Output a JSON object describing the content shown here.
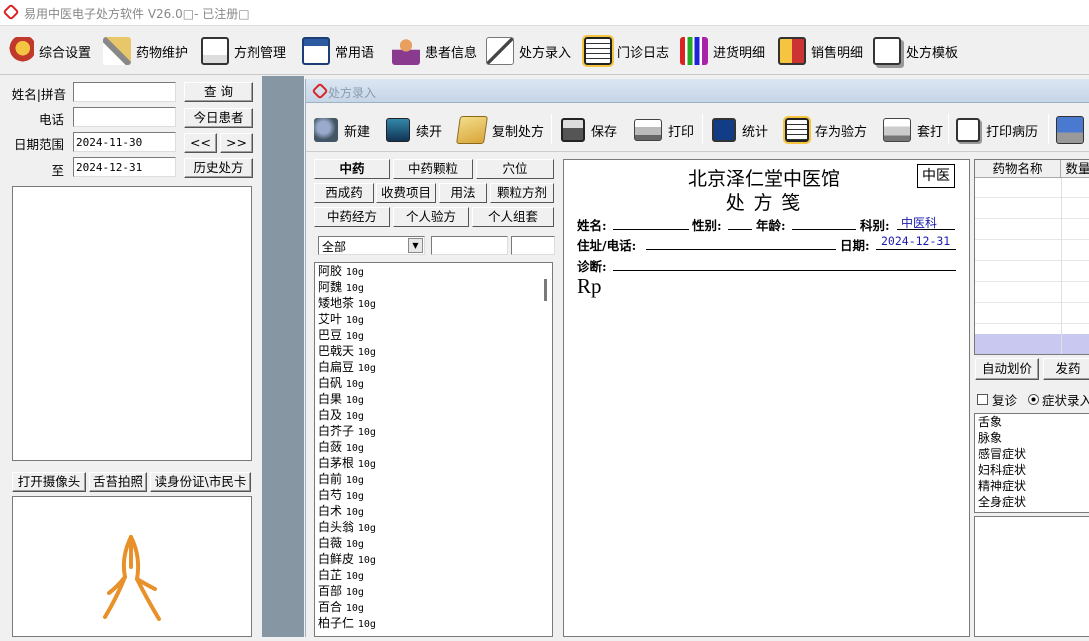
{
  "app": {
    "title": "易用中医电子处方软件 V26.0□- 已注册□"
  },
  "toolbar": [
    {
      "label": "综合设置",
      "icon": "settings-icon"
    },
    {
      "label": "药物维护",
      "icon": "medicine-icon"
    },
    {
      "label": "方剂管理",
      "icon": "formula-icon"
    },
    {
      "label": "常用语",
      "icon": "phrases-icon"
    },
    {
      "label": "患者信息",
      "icon": "patients-icon"
    },
    {
      "label": "处方录入",
      "icon": "prescription-icon"
    },
    {
      "label": "门诊日志",
      "icon": "clinic-log-icon"
    },
    {
      "label": "进货明细",
      "icon": "purchase-chart-icon"
    },
    {
      "label": "销售明细",
      "icon": "sales-icon"
    },
    {
      "label": "处方模板",
      "icon": "template-icon"
    }
  ],
  "left": {
    "name_label": "姓名|拼音",
    "phone_label": "电话",
    "date_label": "日期范围",
    "to_label": "至",
    "date_from": "2024-11-30",
    "date_to": "2024-12-31",
    "query_btn": "查  询",
    "today_btn": "今日患者",
    "prev_btn": "<<",
    "next_btn": ">>",
    "history_btn": "历史处方",
    "camera_btn": "打开摄像头",
    "tongue_btn": "舌苔拍照",
    "idcard_btn": "读身份证\\市民卡"
  },
  "window": {
    "title": "处方录入",
    "toolbar": [
      {
        "label": "新建",
        "icon": "new-icon"
      },
      {
        "label": "续开",
        "icon": "continue-icon"
      },
      {
        "label": "复制处方",
        "icon": "copy-folder-icon"
      },
      {
        "label": "保存",
        "icon": "save-icon"
      },
      {
        "label": "打印",
        "icon": "printer-icon"
      },
      {
        "label": "统计",
        "icon": "stats-icon"
      },
      {
        "label": "存为验方",
        "icon": "save-recipe-icon"
      },
      {
        "label": "套打",
        "icon": "overlay-print-icon"
      },
      {
        "label": "打印病历",
        "icon": "print-record-icon"
      }
    ]
  },
  "tabs": {
    "row1": [
      "中药",
      "中药颗粒",
      "穴位"
    ],
    "row2": [
      "西成药",
      "收费项目",
      "用法",
      "颗粒方剂"
    ],
    "row3": [
      "中药经方",
      "个人验方",
      "个人组套"
    ]
  },
  "filter": {
    "category": "全部"
  },
  "herbs": [
    {
      "name": "阿胶",
      "dose": "10g"
    },
    {
      "name": "阿魏",
      "dose": "10g"
    },
    {
      "name": "矮地茶",
      "dose": "10g"
    },
    {
      "name": "艾叶",
      "dose": "10g"
    },
    {
      "name": "巴豆",
      "dose": "10g"
    },
    {
      "name": "巴戟天",
      "dose": "10g"
    },
    {
      "name": "白扁豆",
      "dose": "10g"
    },
    {
      "name": "白矾",
      "dose": "10g"
    },
    {
      "name": "白果",
      "dose": "10g"
    },
    {
      "name": "白及",
      "dose": "10g"
    },
    {
      "name": "白芥子",
      "dose": "10g"
    },
    {
      "name": "白蔹",
      "dose": "10g"
    },
    {
      "name": "白茅根",
      "dose": "10g"
    },
    {
      "name": "白前",
      "dose": "10g"
    },
    {
      "name": "白芍",
      "dose": "10g"
    },
    {
      "name": "白术",
      "dose": "10g"
    },
    {
      "name": "白头翁",
      "dose": "10g"
    },
    {
      "name": "白薇",
      "dose": "10g"
    },
    {
      "name": "白鲜皮",
      "dose": "10g"
    },
    {
      "name": "白芷",
      "dose": "10g"
    },
    {
      "name": "百部",
      "dose": "10g"
    },
    {
      "name": "百合",
      "dose": "10g"
    },
    {
      "name": "柏子仁",
      "dose": "10g"
    }
  ],
  "rx": {
    "clinic": "北京泽仁堂中医馆",
    "heading": "处  方  笺",
    "badge": "中医",
    "name_lbl": "姓名:",
    "sex_lbl": "性别:",
    "age_lbl": "年龄:",
    "dept_lbl": "科别:",
    "dept_val": "中医科",
    "addr_lbl": "住址/电话:",
    "date_lbl": "日期:",
    "date_val": "2024-12-31",
    "diag_lbl": "诊断:",
    "rp": "Rp"
  },
  "grid": {
    "col1": "药物名称",
    "col2": "数量"
  },
  "right": {
    "auto_price": "自动划价",
    "dispense": "发药",
    "revisit": "复诊",
    "symptom_entry": "症状录入",
    "symptoms": [
      "舌象",
      "脉象",
      "感冒症状",
      "妇科症状",
      "精神症状",
      "全身症状"
    ]
  },
  "colors": {
    "accent": "#1a1ab0",
    "gutter": "#8796a3",
    "selected_row": "#c8c8f0"
  }
}
